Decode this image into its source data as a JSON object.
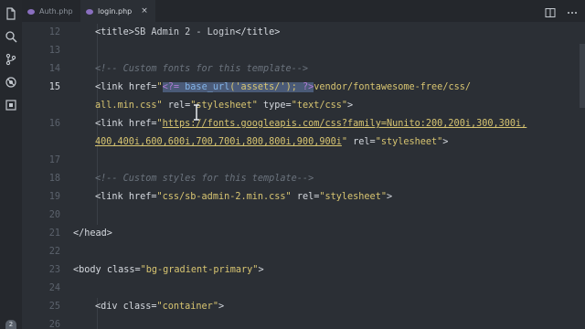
{
  "tabs": [
    {
      "label": "Auth.php",
      "active": false
    },
    {
      "label": "login.php",
      "active": true,
      "close": "×"
    }
  ],
  "activity_icons": [
    "files-icon",
    "search-icon",
    "source-control-icon",
    "debug-icon",
    "extensions-icon"
  ],
  "badge": "2",
  "line_numbers": [
    "12",
    "13",
    "14",
    "15",
    "",
    "16",
    "",
    "17",
    "18",
    "19",
    "20",
    "21",
    "22",
    "23",
    "24",
    "25",
    "26"
  ],
  "active_line": "15",
  "code": {
    "l12": {
      "open": "<title>",
      "text": "SB Admin 2 - Login",
      "close": "</title>"
    },
    "l14": "<!-- Custom fonts for this template-->",
    "l15a": {
      "tag": "<link ",
      "attr": "href=",
      "q": "\"",
      "php_open": "<?=",
      "fn": " base_url",
      "args": "('assets/'); ",
      "php_close": "?>",
      "rest": "vendor/fontawesome-free/css/"
    },
    "l15b": {
      "rest": "all.min.css\"",
      "attr2": " rel=",
      "v2": "\"stylesheet\"",
      "attr3": " type=",
      "v3": "\"text/css\"",
      "end": ">"
    },
    "l16a": {
      "tag": "<link ",
      "attr": "href=",
      "q": "\"",
      "url": "https://fonts.googleapis.com/css?family=Nunito:200,200i,300,300i,"
    },
    "l16b": {
      "url": "400,400i,600,600i,700,700i,800,800i,900,900i",
      "q": "\"",
      "attr2": " rel=",
      "v2": "\"stylesheet\"",
      "end": ">"
    },
    "l18": "<!-- Custom styles for this template-->",
    "l19": {
      "tag": "<link ",
      "attr": "href=",
      "v": "\"css/sb-admin-2.min.css\"",
      "attr2": " rel=",
      "v2": "\"stylesheet\"",
      "end": ">"
    },
    "l21": "</head>",
    "l23": {
      "tag": "<body ",
      "attr": "class=",
      "v": "\"bg-gradient-primary\"",
      "end": ">"
    },
    "l25": {
      "tag": "<div ",
      "attr": "class=",
      "v": "\"container\"",
      "end": ">"
    }
  },
  "colors": {
    "background": "#2b2f35",
    "string": "#d8c571",
    "php": "#b07bd6",
    "function": "#83b4e8",
    "comment": "#6b737d",
    "selection": "#4a5a77"
  }
}
